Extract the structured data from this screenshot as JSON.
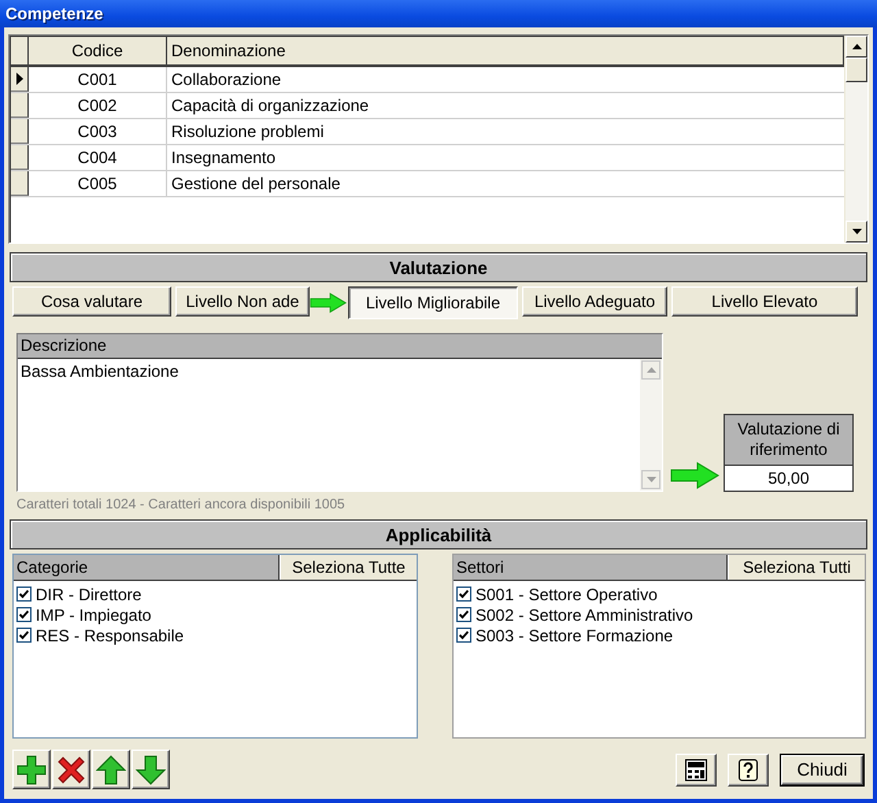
{
  "window": {
    "title": "Competenze"
  },
  "grid": {
    "columns": [
      "Codice",
      "Denominazione"
    ],
    "rows": [
      {
        "code": "C001",
        "name": "Collaborazione",
        "selected": true
      },
      {
        "code": "C002",
        "name": "Capacità di organizzazione",
        "selected": false
      },
      {
        "code": "C003",
        "name": "Risoluzione problemi",
        "selected": false
      },
      {
        "code": "C004",
        "name": "Insegnamento",
        "selected": false
      },
      {
        "code": "C005",
        "name": "Gestione del personale",
        "selected": false
      }
    ]
  },
  "valutazione": {
    "title": "Valutazione",
    "tabs": [
      {
        "label": "Cosa valutare",
        "selected": false
      },
      {
        "label": "Livello Non ade",
        "selected": false
      },
      {
        "label": "Livello Migliorabile",
        "selected": true
      },
      {
        "label": "Livello Adeguato",
        "selected": false
      },
      {
        "label": "Livello Elevato",
        "selected": false
      }
    ],
    "description": {
      "label": "Descrizione",
      "value": "Bassa Ambientazione"
    },
    "reference": {
      "label": "Valutazione di riferimento",
      "value": "50,00"
    },
    "char_count": "Caratteri totali 1024 - Caratteri ancora disponibili 1005"
  },
  "applicabilita": {
    "title": "Applicabilità",
    "lists": [
      {
        "label": "Categorie",
        "select_all": "Seleziona Tutte",
        "items": [
          {
            "label": "DIR - Direttore",
            "checked": true
          },
          {
            "label": "IMP - Impiegato",
            "checked": true
          },
          {
            "label": "RES - Responsabile",
            "checked": true
          }
        ]
      },
      {
        "label": "Settori",
        "select_all": "Seleziona Tutti",
        "items": [
          {
            "label": "S001 - Settore Operativo",
            "checked": true
          },
          {
            "label": "S002 - Settore Amministrativo",
            "checked": true
          },
          {
            "label": "S003 - Settore Formazione",
            "checked": true
          }
        ]
      }
    ]
  },
  "toolbar": {
    "left": [
      {
        "kind": "add"
      },
      {
        "kind": "delete"
      },
      {
        "kind": "up"
      },
      {
        "kind": "down"
      }
    ],
    "right": [
      {
        "kind": "calc"
      },
      {
        "kind": "help"
      },
      {
        "kind": "text",
        "label": "Chiudi"
      }
    ]
  }
}
